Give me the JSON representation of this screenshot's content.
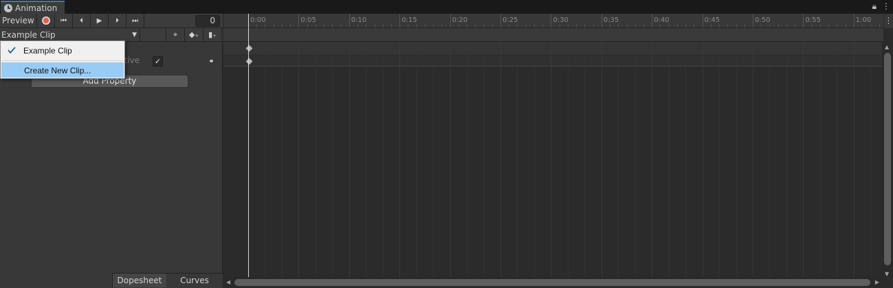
{
  "window": {
    "tab_title": "Animation",
    "lock_icon": "lock-icon",
    "menu_icon": "kebab-menu-icon"
  },
  "toolbar": {
    "preview_label": "Preview",
    "frame_value": "0",
    "buttons": [
      "record-icon",
      "skip-to-start-icon",
      "previous-key-icon",
      "play-icon",
      "next-key-icon",
      "skip-to-end-icon"
    ]
  },
  "clip_toolbar": {
    "clip_name": "Example Clip",
    "buttons": [
      "snap-icon",
      "add-keyframe-icon",
      "add-event-icon"
    ]
  },
  "property": {
    "label": "ctive",
    "checked": "✓"
  },
  "add_property_label": "Add Property",
  "bottom_tabs": {
    "dopesheet": "Dopesheet",
    "curves": "Curves"
  },
  "ruler": {
    "labels": [
      "0:00",
      "0:05",
      "0:10",
      "0:15",
      "0:20",
      "0:25",
      "0:30",
      "0:35",
      "0:40",
      "0:45",
      "0:50",
      "0:55",
      "1:00"
    ]
  },
  "dropdown": {
    "items": [
      {
        "label": "Example Clip",
        "checked": true
      },
      {
        "label": "Create New Clip...",
        "highlighted": true
      }
    ]
  },
  "colors": {
    "accent": "#3a79bb",
    "record": "#f05a40",
    "menu_highlight": "#99ccf5"
  }
}
